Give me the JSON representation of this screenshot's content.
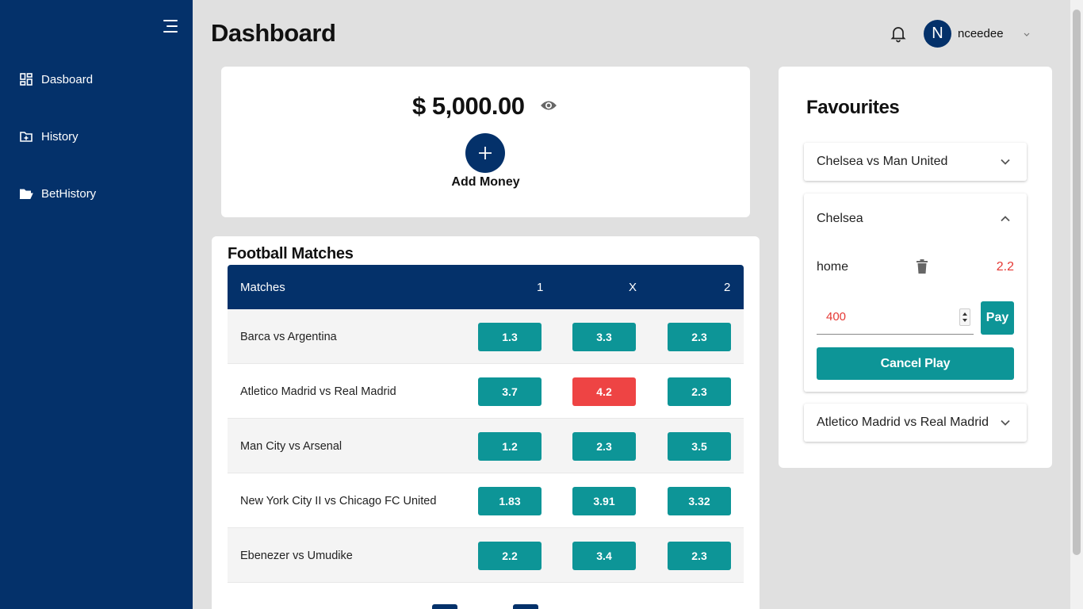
{
  "sidebar": {
    "items": [
      {
        "label": "Dasboard",
        "icon": "dashboard-icon"
      },
      {
        "label": "History",
        "icon": "folder-plus-icon"
      },
      {
        "label": "BetHistory",
        "icon": "folder-open-icon"
      }
    ]
  },
  "header": {
    "title": "Dashboard",
    "avatar_initial": "N",
    "username": "nceedee"
  },
  "balance": {
    "amount": "$ 5,000.00",
    "add_label": "Add Money"
  },
  "matches": {
    "title": "Football Matches",
    "columns": [
      "Matches",
      "1",
      "X",
      "2"
    ],
    "rows": [
      {
        "name": "Barca vs Argentina",
        "odds": [
          "1.3",
          "3.3",
          "2.3"
        ],
        "selected": null
      },
      {
        "name": "Atletico Madrid vs Real Madrid",
        "odds": [
          "3.7",
          "4.2",
          "2.3"
        ],
        "selected": 1
      },
      {
        "name": "Man City vs Arsenal",
        "odds": [
          "1.2",
          "2.3",
          "3.5"
        ],
        "selected": null
      },
      {
        "name": "New York City II vs Chicago FC United",
        "odds": [
          "1.83",
          "3.91",
          "3.32"
        ],
        "selected": null
      },
      {
        "name": "Ebenezer vs Umudike",
        "odds": [
          "2.2",
          "3.4",
          "2.3"
        ],
        "selected": null
      }
    ]
  },
  "favourites": {
    "title": "Favourites",
    "items": [
      {
        "title": "Chelsea vs Man United",
        "expanded": false
      },
      {
        "title": "Chelsea",
        "expanded": true,
        "bet_type": "home",
        "odd": "2.2",
        "stake": "400",
        "pay_label": "Pay",
        "cancel_label": "Cancel Play"
      },
      {
        "title": "Atletico Madrid vs Real Madrid",
        "expanded": false
      }
    ]
  },
  "colors": {
    "navy": "#04316a",
    "teal": "#0d9597",
    "red": "#ee4444",
    "background": "#e0e0e0"
  }
}
